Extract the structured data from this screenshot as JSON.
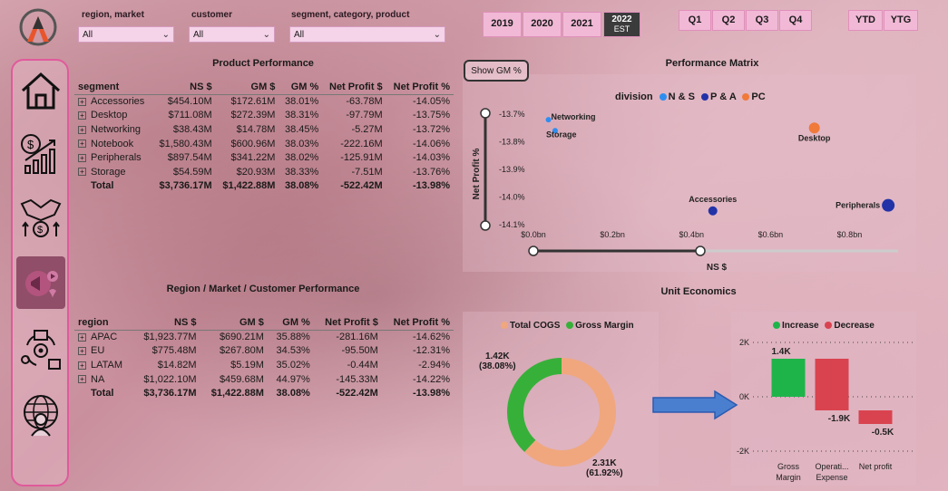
{
  "filters": {
    "region_market": {
      "label": "region, market",
      "value": "All"
    },
    "customer": {
      "label": "customer",
      "value": "All"
    },
    "segment_category_product": {
      "label": "segment, category, product",
      "value": "All"
    }
  },
  "years": [
    {
      "label": "2019"
    },
    {
      "label": "2020"
    },
    {
      "label": "2021"
    },
    {
      "label": "2022",
      "sub": "EST",
      "selected": true
    }
  ],
  "quarters": [
    {
      "label": "Q1"
    },
    {
      "label": "Q2"
    },
    {
      "label": "Q3"
    },
    {
      "label": "Q4"
    }
  ],
  "period": [
    {
      "label": "YTD"
    },
    {
      "label": "YTG"
    }
  ],
  "nav": [
    {
      "name": "home-icon"
    },
    {
      "name": "finance-icon"
    },
    {
      "name": "sales-icon"
    },
    {
      "name": "marketing-icon",
      "active": true
    },
    {
      "name": "supply-chain-icon"
    },
    {
      "name": "executive-icon"
    }
  ],
  "product_performance": {
    "title": "Product Performance",
    "columns": [
      "segment",
      "NS $",
      "GM $",
      "GM %",
      "Net Profit $",
      "Net Profit %"
    ],
    "rows": [
      {
        "cells": [
          "Accessories",
          "$454.10M",
          "$172.61M",
          "38.01%",
          "-63.78M",
          "-14.05%"
        ]
      },
      {
        "cells": [
          "Desktop",
          "$711.08M",
          "$272.39M",
          "38.31%",
          "-97.79M",
          "-13.75%"
        ]
      },
      {
        "cells": [
          "Networking",
          "$38.43M",
          "$14.78M",
          "38.45%",
          "-5.27M",
          "-13.72%"
        ]
      },
      {
        "cells": [
          "Notebook",
          "$1,580.43M",
          "$600.96M",
          "38.03%",
          "-222.16M",
          "-14.06%"
        ]
      },
      {
        "cells": [
          "Peripherals",
          "$897.54M",
          "$341.22M",
          "38.02%",
          "-125.91M",
          "-14.03%"
        ]
      },
      {
        "cells": [
          "Storage",
          "$54.59M",
          "$20.93M",
          "38.33%",
          "-7.51M",
          "-13.76%"
        ]
      }
    ],
    "total": [
      "Total",
      "$3,736.17M",
      "$1,422.88M",
      "38.08%",
      "-522.42M",
      "-13.98%"
    ]
  },
  "region_performance": {
    "title": "Region / Market / Customer Performance",
    "columns": [
      "region",
      "NS $",
      "GM $",
      "GM %",
      "Net Profit $",
      "Net Profit %"
    ],
    "rows": [
      {
        "cells": [
          "APAC",
          "$1,923.77M",
          "$690.21M",
          "35.88%",
          "-281.16M",
          "-14.62%"
        ]
      },
      {
        "cells": [
          "EU",
          "$775.48M",
          "$267.80M",
          "34.53%",
          "-95.50M",
          "-12.31%"
        ]
      },
      {
        "cells": [
          "LATAM",
          "$14.82M",
          "$5.19M",
          "35.02%",
          "-0.44M",
          "-2.94%"
        ]
      },
      {
        "cells": [
          "NA",
          "$1,022.10M",
          "$459.68M",
          "44.97%",
          "-145.33M",
          "-14.22%"
        ]
      }
    ],
    "total": [
      "Total",
      "$3,736.17M",
      "$1,422.88M",
      "38.08%",
      "-522.42M",
      "-13.98%"
    ]
  },
  "performance_matrix": {
    "title": "Performance Matrix",
    "toggle_label": "Show GM %",
    "legend_title": "division",
    "y_axis_label": "Net Profit %",
    "x_axis_label": "NS $"
  },
  "unit_economics": {
    "title": "Unit Economics",
    "donut_legend": [
      {
        "label": "Total COGS",
        "color": "#f0a77e"
      },
      {
        "label": "Gross Margin",
        "color": "#37b03a"
      }
    ],
    "donut_labels": {
      "gm_value": "1.42K",
      "gm_pct": "(38.08%)",
      "cogs_value": "2.31K",
      "cogs_pct": "(61.92%)"
    },
    "waterfall_legend": [
      {
        "label": "Increase",
        "color": "#1fb44a"
      },
      {
        "label": "Decrease",
        "color": "#d9434f"
      }
    ]
  },
  "chart_data": [
    {
      "type": "scatter",
      "legend": [
        {
          "name": "N & S",
          "color": "#2e8ef0"
        },
        {
          "name": "P & A",
          "color": "#2233a8"
        },
        {
          "name": "PC",
          "color": "#f07a3a"
        }
      ],
      "x_ticks": [
        "$0.0bn",
        "$0.2bn",
        "$0.4bn",
        "$0.6bn",
        "$0.8bn"
      ],
      "y_ticks": [
        "-13.7%",
        "-13.8%",
        "-13.9%",
        "-14.0%",
        "-14.1%"
      ],
      "xlim": [
        0,
        0.9
      ],
      "ylim": [
        -14.1,
        -13.7
      ],
      "points": [
        {
          "label": "Networking",
          "division": "N & S",
          "x": 0.038,
          "y": -13.72,
          "size": 3
        },
        {
          "label": "Storage",
          "division": "N & S",
          "x": 0.055,
          "y": -13.76,
          "size": 3
        },
        {
          "label": "Desktop",
          "division": "PC",
          "x": 0.711,
          "y": -13.75,
          "size": 6
        },
        {
          "label": "Accessories",
          "division": "P & A",
          "x": 0.454,
          "y": -14.05,
          "size": 5
        },
        {
          "label": "Peripherals",
          "division": "P & A",
          "x": 0.898,
          "y": -14.03,
          "size": 7
        }
      ]
    },
    {
      "type": "pie",
      "slices": [
        {
          "name": "Total COGS",
          "value": 2.31,
          "pct": 61.92,
          "color": "#f0a77e"
        },
        {
          "name": "Gross Margin",
          "value": 1.42,
          "pct": 38.08,
          "color": "#37b03a"
        }
      ]
    },
    {
      "type": "bar",
      "subtype": "waterfall",
      "categories": [
        "Gross Margin",
        "Operati... Expense",
        "Net profit"
      ],
      "category_lines": [
        [
          "Gross",
          "Margin"
        ],
        [
          "Operati...",
          "Expense"
        ],
        [
          "Net profit"
        ]
      ],
      "values": [
        1.4,
        -1.9,
        -0.5
      ],
      "labels": [
        "1.4K",
        "-1.9K",
        "-0.5K"
      ],
      "y_ticks": [
        "2K",
        "0K",
        "-2K"
      ],
      "ylim": [
        -2,
        2
      ]
    }
  ]
}
